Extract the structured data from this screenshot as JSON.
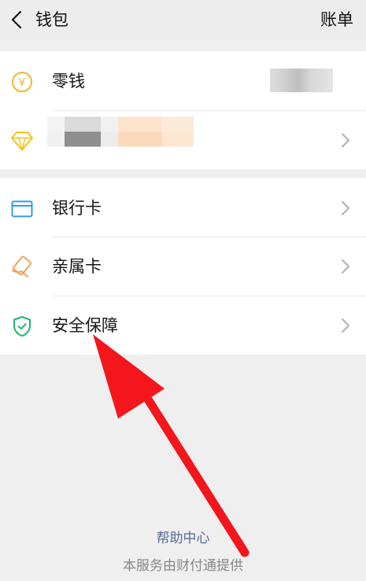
{
  "header": {
    "title": "钱包",
    "bill_label": "账单",
    "back_icon": "chevron-left-icon"
  },
  "balance_section": {
    "change": {
      "label": "零钱",
      "icon": "yen-coin-icon",
      "icon_color": "#f2b531",
      "value_redacted": true
    },
    "wealth": {
      "icon": "diamond-icon",
      "icon_color": "#f2c21b",
      "label_redacted": true
    }
  },
  "cards_section": {
    "items": [
      {
        "label": "银行卡",
        "icon": "bank-card-icon",
        "icon_color": "#2c9cf2"
      },
      {
        "label": "亲属卡",
        "icon": "family-card-icon",
        "icon_color": "#f5a05a"
      },
      {
        "label": "安全保障",
        "icon": "shield-check-icon",
        "icon_color": "#1fb66e"
      }
    ]
  },
  "footer": {
    "help_center": "帮助中心",
    "provider": "本服务由财付通提供"
  },
  "colors": {
    "page_background": "#efefef",
    "link": "#576b95",
    "annotation_arrow": "#f3161c"
  }
}
